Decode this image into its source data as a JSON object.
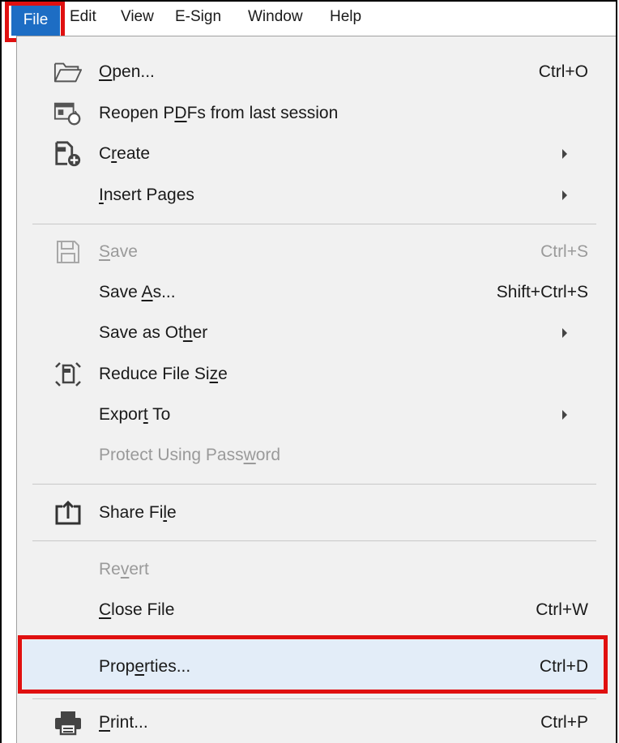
{
  "menubar": {
    "items": [
      {
        "label": "File",
        "active": true
      },
      {
        "label": "Edit"
      },
      {
        "label": "View"
      },
      {
        "label": "E-Sign"
      },
      {
        "label": "Window"
      },
      {
        "label": "Help"
      }
    ]
  },
  "file_menu": {
    "items": [
      {
        "label_pre": "",
        "label_u": "O",
        "label_post": "pen...",
        "shortcut": "Ctrl+O",
        "icon": "folder-open-icon"
      },
      {
        "label_pre": "Reopen P",
        "label_u": "D",
        "label_post": "Fs from last session",
        "shortcut": "",
        "icon": "reopen-session-icon"
      },
      {
        "label_pre": "C",
        "label_u": "r",
        "label_post": "eate",
        "shortcut": "",
        "icon": "create-pdf-icon",
        "submenu": true
      },
      {
        "label_pre": "",
        "label_u": "I",
        "label_post": "nsert Pages",
        "shortcut": "",
        "submenu": true
      },
      {
        "label_pre": "",
        "label_u": "S",
        "label_post": "ave",
        "shortcut": "Ctrl+S",
        "icon": "save-icon",
        "disabled": true
      },
      {
        "label_pre": "Save ",
        "label_u": "A",
        "label_post": "s...",
        "shortcut": "Shift+Ctrl+S"
      },
      {
        "label_pre": "Save as Ot",
        "label_u": "h",
        "label_post": "er",
        "shortcut": "",
        "submenu": true
      },
      {
        "label_pre": "Reduce File Si",
        "label_u": "z",
        "label_post": "e",
        "shortcut": "",
        "icon": "reduce-size-icon"
      },
      {
        "label_pre": "Expor",
        "label_u": "t",
        "label_post": " To",
        "shortcut": "",
        "submenu": true
      },
      {
        "label_pre": "Protect Using Pass",
        "label_u": "w",
        "label_post": "ord",
        "shortcut": "",
        "disabled": true
      },
      {
        "label_pre": "Share Fi",
        "label_u": "l",
        "label_post": "e",
        "shortcut": "",
        "icon": "share-icon"
      },
      {
        "label_pre": "Re",
        "label_u": "v",
        "label_post": "ert",
        "shortcut": "",
        "disabled": true
      },
      {
        "label_pre": "",
        "label_u": "C",
        "label_post": "lose File",
        "shortcut": "Ctrl+W"
      },
      {
        "label_pre": "Prop",
        "label_u": "e",
        "label_post": "rties...",
        "shortcut": "Ctrl+D",
        "highlighted": true
      },
      {
        "label_pre": "",
        "label_u": "P",
        "label_post": "rint...",
        "shortcut": "Ctrl+P",
        "icon": "printer-icon"
      }
    ]
  },
  "colors": {
    "file_active_bg": "#1d6dc4",
    "annotation_red": "#e01010",
    "menu_bg": "#f1f1f1",
    "highlight_bg": "#e3edf8",
    "disabled_text": "#9a9a9a"
  }
}
